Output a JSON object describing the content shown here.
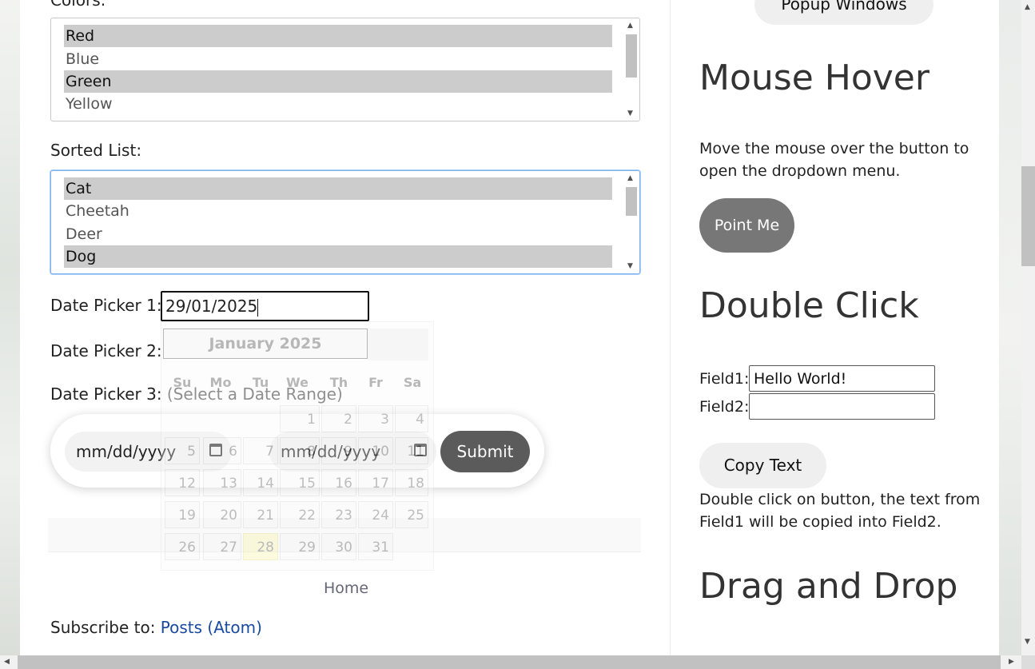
{
  "left": {
    "colors_label": "Colors:",
    "colors_options": [
      {
        "label": "Red",
        "selected": true
      },
      {
        "label": "Blue",
        "selected": false
      },
      {
        "label": "Green",
        "selected": true
      },
      {
        "label": "Yellow",
        "selected": false
      }
    ],
    "sorted_label": "Sorted List:",
    "sorted_options": [
      {
        "label": "Cat",
        "selected": true
      },
      {
        "label": "Cheetah",
        "selected": false
      },
      {
        "label": "Deer",
        "selected": false
      },
      {
        "label": "Dog",
        "selected": true
      }
    ],
    "dp1_label": "Date Picker 1:",
    "dp1_value": "29/01/2025",
    "dp2_label": "Date Picker 2:",
    "dp3_label": "Date Picker 3:",
    "dp3_hint": "(Select a Date Range)",
    "range_start_placeholder": "mm/dd/yyyy",
    "range_end_placeholder": "mm/dd/yyyy",
    "submit_label": "Submit",
    "home_link": "Home",
    "subscribe_prefix": "Subscribe to:",
    "subscribe_link": "Posts (Atom)"
  },
  "datepicker": {
    "month_title": "January 2025",
    "weekdays": [
      "Su",
      "Mo",
      "Tu",
      "We",
      "Th",
      "Fr",
      "Sa"
    ],
    "weeks": [
      [
        "",
        "",
        "",
        "1",
        "2",
        "3",
        "4"
      ],
      [
        "5",
        "6",
        "7",
        "8",
        "9",
        "10",
        "11"
      ],
      [
        "12",
        "13",
        "14",
        "15",
        "16",
        "17",
        "18"
      ],
      [
        "19",
        "20",
        "21",
        "22",
        "23",
        "24",
        "25"
      ],
      [
        "26",
        "27",
        "28",
        "29",
        "30",
        "31",
        ""
      ]
    ],
    "highlighted_day": "28"
  },
  "right": {
    "popup_button": "Popup Windows",
    "mouse_hover_title": "Mouse Hover",
    "mouse_hover_desc_line1": "Move the mouse over the button to",
    "mouse_hover_desc_line2": "open the dropdown menu.",
    "point_me": "Point Me",
    "double_click_title": "Double Click",
    "field1_label": "Field1:",
    "field1_value": "Hello World!",
    "field2_label": "Field2:",
    "field2_value": "",
    "copy_text_button": "Copy Text",
    "dc_desc_line1": "Double click on button, the text from",
    "dc_desc_line2": "Field1 will be copied into Field2.",
    "drag_drop_title": "Drag and Drop"
  },
  "colors": {
    "accent_gray": "#777777",
    "submit_bg": "#5b5b5b",
    "link": "#1a4aa0",
    "today_highlight": "#fbf4a5",
    "selected_option_bg": "#cccccc"
  }
}
